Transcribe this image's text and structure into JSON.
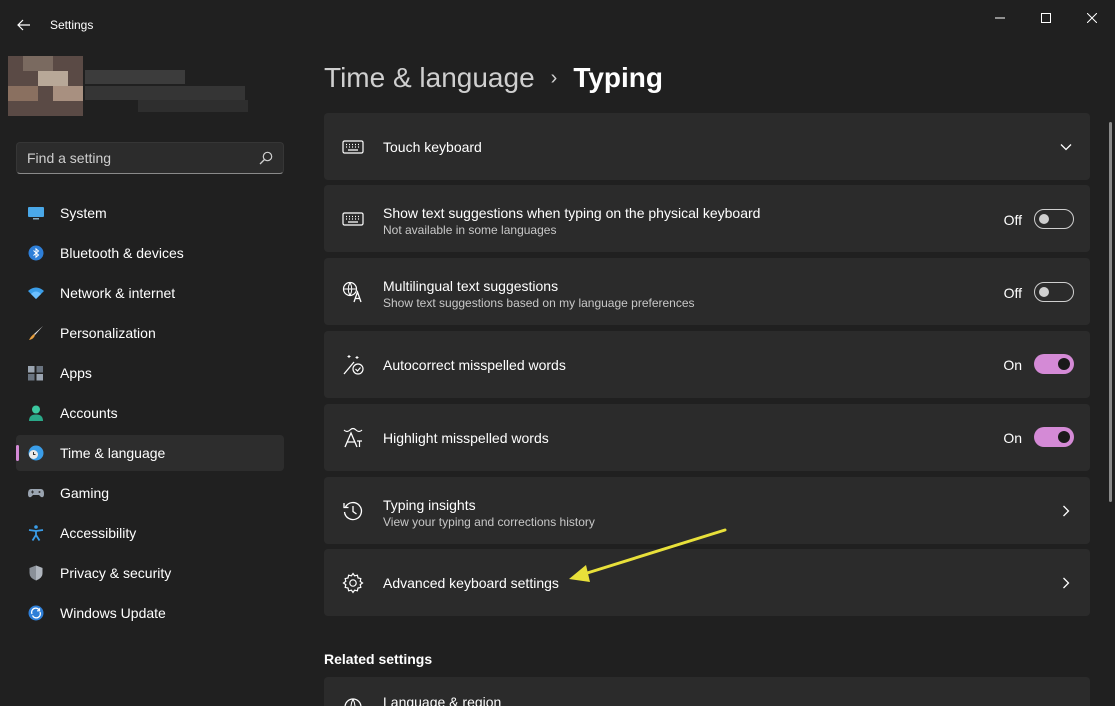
{
  "window": {
    "title": "Settings"
  },
  "search": {
    "placeholder": "Find a setting"
  },
  "sidebar": {
    "items": [
      {
        "label": "System",
        "icon": "monitor-icon"
      },
      {
        "label": "Bluetooth & devices",
        "icon": "bluetooth-icon"
      },
      {
        "label": "Network & internet",
        "icon": "wifi-icon"
      },
      {
        "label": "Personalization",
        "icon": "brush-icon"
      },
      {
        "label": "Apps",
        "icon": "apps-icon"
      },
      {
        "label": "Accounts",
        "icon": "person-icon"
      },
      {
        "label": "Time & language",
        "icon": "globe-clock-icon",
        "selected": true
      },
      {
        "label": "Gaming",
        "icon": "gamepad-icon"
      },
      {
        "label": "Accessibility",
        "icon": "accessibility-icon"
      },
      {
        "label": "Privacy & security",
        "icon": "shield-icon"
      },
      {
        "label": "Windows Update",
        "icon": "update-icon"
      }
    ]
  },
  "header": {
    "parent": "Time & language",
    "separator": "›",
    "current": "Typing"
  },
  "settings": {
    "touch_keyboard": {
      "title": "Touch keyboard"
    },
    "text_suggestions": {
      "title": "Show text suggestions when typing on the physical keyboard",
      "subtitle": "Not available in some languages",
      "state": "Off"
    },
    "multilingual": {
      "title": "Multilingual text suggestions",
      "subtitle": "Show text suggestions based on my language preferences",
      "state": "Off"
    },
    "autocorrect": {
      "title": "Autocorrect misspelled words",
      "state": "On"
    },
    "highlight": {
      "title": "Highlight misspelled words",
      "state": "On"
    },
    "typing_insights": {
      "title": "Typing insights",
      "subtitle": "View your typing and corrections history"
    },
    "advanced_keyboard": {
      "title": "Advanced keyboard settings"
    }
  },
  "related": {
    "heading": "Related settings",
    "items": [
      {
        "title": "Language & region"
      }
    ]
  },
  "colors": {
    "accent": "#d48ad6",
    "annotation_arrow": "#e8e03a",
    "card": "#2b2b2b",
    "background": "#202020"
  }
}
